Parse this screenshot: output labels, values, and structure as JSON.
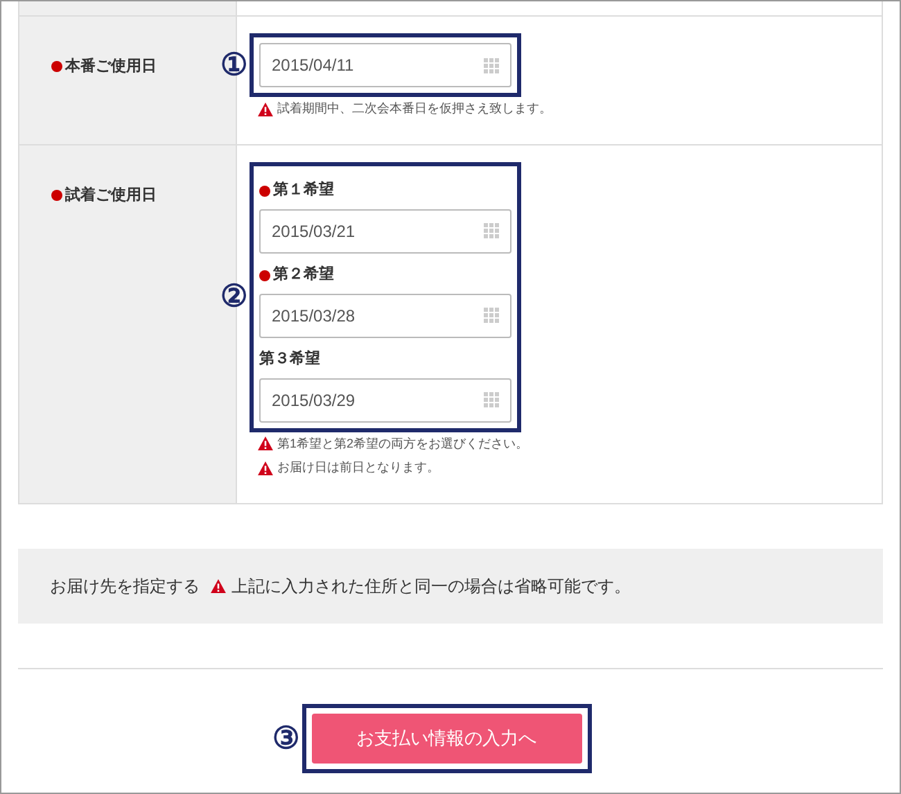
{
  "rows": [
    {
      "label": "本番ご使用日",
      "required": true,
      "callout": "①",
      "fields": [
        {
          "value": "2015/04/11"
        }
      ],
      "notes": [
        "試着期間中、二次会本番日を仮押さえ致します。"
      ]
    },
    {
      "label": "試着ご使用日",
      "required": true,
      "callout": "②",
      "fields": [
        {
          "label": "第１希望",
          "required": true,
          "value": "2015/03/21"
        },
        {
          "label": "第２希望",
          "required": true,
          "value": "2015/03/28"
        },
        {
          "label": "第３希望",
          "required": false,
          "value": "2015/03/29"
        }
      ],
      "notes": [
        "第1希望と第2希望の両方をお選びください。",
        "お届け日は前日となります。"
      ]
    }
  ],
  "delivery": {
    "label": "お届け先を指定する",
    "note": "上記に入力された住所と同一の場合は省略可能です。"
  },
  "submit": {
    "callout": "③",
    "label": "お支払い情報の入力へ"
  }
}
